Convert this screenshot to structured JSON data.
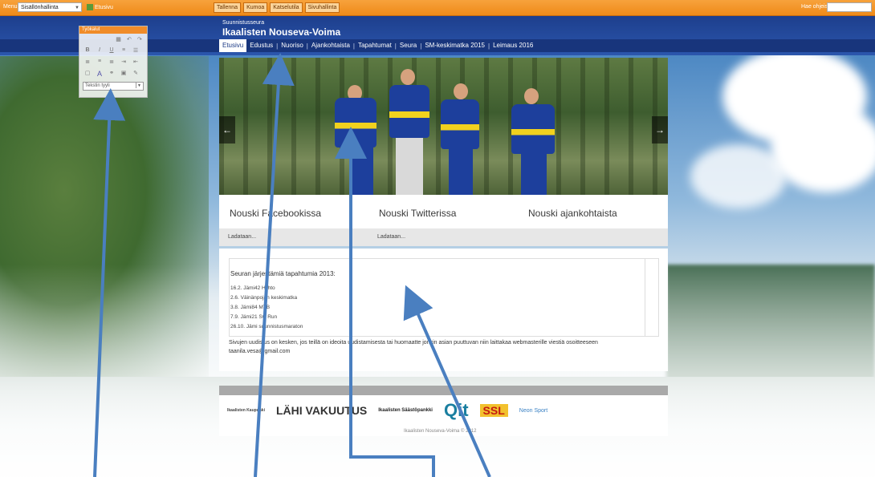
{
  "admin": {
    "menu_label": "Menu",
    "section_select": "Sisällönhallinta",
    "home_link": "Etusivu",
    "buttons": [
      "Tallenna",
      "Kumoa",
      "Katselutila",
      "Sivuhallinta"
    ],
    "search_label": "Hae ohjeista",
    "search_value": ""
  },
  "toolpanel": {
    "title": "Työkalut",
    "style_placeholder": "Tekstin tyyli"
  },
  "site": {
    "subtitle": "Suunnistusseura",
    "title": "Ikaalisten Nouseva-Voima"
  },
  "nav": [
    "Etusivu",
    "Edustus",
    "Nuoriso",
    "Ajankohtaista",
    "Tapahtumat",
    "Seura",
    "SM-keskimatka 2015",
    "Leimaus 2016"
  ],
  "hero": {
    "prev": "←",
    "next": "→"
  },
  "columns": [
    "Nouski Facebookissa",
    "Nouski Twitterissa",
    "Nouski ajankohtaista"
  ],
  "loading": [
    "Ladataan...",
    "Ladataan..."
  ],
  "events": {
    "title": "Seuran järjestämiä tapahtumia 2013:",
    "items": [
      "16.2. Jämi42 Hiihto",
      "2.6. Väinänpojan keskimatka",
      "3.8. Jämi84 MTB",
      "7.9. Jämi21 SC Run",
      "26.10. Jämi suunnistusmaraton"
    ],
    "note": "Sivujen uudistus on kesken, jos teillä on ideoita uudistamisesta tai huomaatte jonkin asian puuttuvan niin laittakaa webmasterille viestiä osoitteeseen taanila.vesa@gmail.com"
  },
  "sponsors": [
    "Ikaalisten Kaupunki",
    "LÄHI VAKUUTUS",
    "Ikaalisten Säästöpankki",
    "Qit",
    "SSL",
    "Neon Sport"
  ],
  "footer": {
    "copyright": "Ikaalisten Nouseva-Voima © 2012"
  },
  "colors": {
    "admin_bar": "#ef8a18",
    "header": "#1d3e8c",
    "nav_bg": "#18357c",
    "annotation": "#4a7fc0"
  }
}
